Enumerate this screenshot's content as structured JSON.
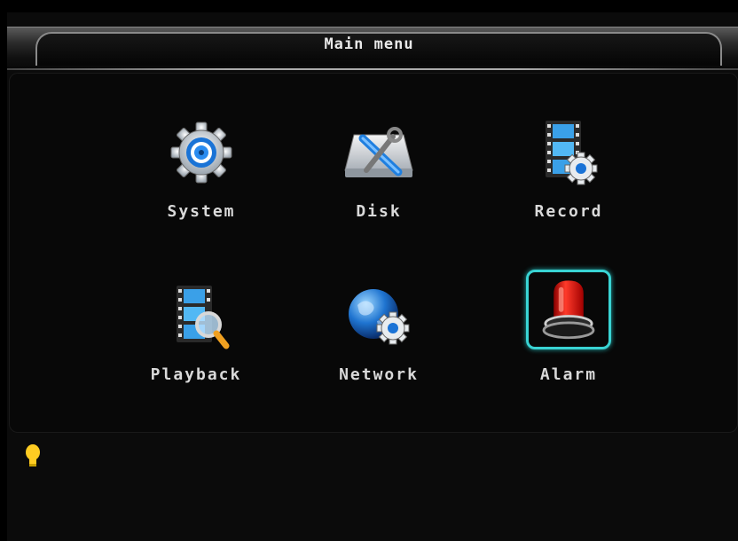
{
  "window": {
    "title": "Main menu"
  },
  "menu": {
    "items": [
      {
        "label": "System",
        "icon": "gear-icon"
      },
      {
        "label": "Disk",
        "icon": "disk-tools-icon"
      },
      {
        "label": "Record",
        "icon": "film-gear-icon"
      },
      {
        "label": "Playback",
        "icon": "film-magnifier-icon"
      },
      {
        "label": "Network",
        "icon": "globe-gear-icon"
      },
      {
        "label": "Alarm",
        "icon": "alarm-beacon-icon"
      }
    ],
    "selected": "Alarm"
  },
  "status": {
    "icon": "lightbulb-icon"
  },
  "colors": {
    "selection": "#39d3d3",
    "label_text": "#d9d9d9",
    "background": "#080808"
  }
}
